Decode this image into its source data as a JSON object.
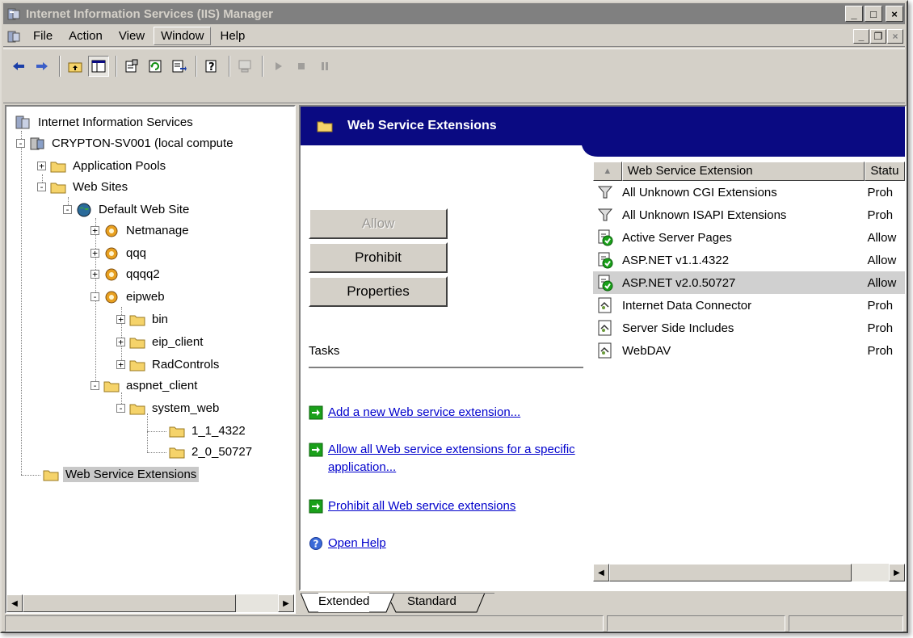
{
  "window": {
    "title": "Internet Information Services (IIS) Manager"
  },
  "caption_buttons": {
    "minimize": "_",
    "maximize": "□",
    "close": "×"
  },
  "menu": {
    "items": [
      {
        "label": "File"
      },
      {
        "label": "Action"
      },
      {
        "label": "View"
      },
      {
        "label": "Window"
      },
      {
        "label": "Help"
      }
    ]
  },
  "tree": {
    "nodes": [
      {
        "label": "Internet Information Services"
      },
      {
        "label": "CRYPTON-SV001 (local compute"
      },
      {
        "label": "Application Pools"
      },
      {
        "label": "Web Sites"
      },
      {
        "label": "Default Web Site"
      },
      {
        "label": "Netmanage"
      },
      {
        "label": "qqq"
      },
      {
        "label": "qqqq2"
      },
      {
        "label": "eipweb"
      },
      {
        "label": "bin"
      },
      {
        "label": "eip_client"
      },
      {
        "label": "RadControls"
      },
      {
        "label": "aspnet_client"
      },
      {
        "label": "system_web"
      },
      {
        "label": "1_1_4322"
      },
      {
        "label": "2_0_50727"
      },
      {
        "label": "Web Service Extensions"
      }
    ],
    "selected": "Web Service Extensions"
  },
  "panel": {
    "header_title": "Web Service Extensions",
    "buttons": {
      "allow": "Allow",
      "prohibit": "Prohibit",
      "properties": "Properties"
    },
    "tasks_label": "Tasks",
    "tasks": [
      {
        "label": "Add a new Web service extension..."
      },
      {
        "label": "Allow all Web service extensions for a specific application..."
      },
      {
        "label": "Prohibit all Web service extensions"
      },
      {
        "label": "Open Help"
      }
    ]
  },
  "list": {
    "sort_glyph": "▲",
    "columns": {
      "name": "Web Service Extension",
      "status": "Statu"
    },
    "rows": [
      {
        "name": "All Unknown CGI Extensions",
        "status": "Proh",
        "icon": "filter-icon"
      },
      {
        "name": "All Unknown ISAPI Extensions",
        "status": "Proh",
        "icon": "filter-icon"
      },
      {
        "name": "Active Server Pages",
        "status": "Allow",
        "icon": "allowed-extension-icon"
      },
      {
        "name": "ASP.NET v1.1.4322",
        "status": "Allow",
        "icon": "allowed-extension-icon"
      },
      {
        "name": "ASP.NET v2.0.50727",
        "status": "Allow",
        "icon": "allowed-extension-icon"
      },
      {
        "name": "Internet Data Connector",
        "status": "Proh",
        "icon": "extension-icon"
      },
      {
        "name": "Server Side Includes",
        "status": "Proh",
        "icon": "extension-icon"
      },
      {
        "name": "WebDAV",
        "status": "Proh",
        "icon": "extension-icon"
      }
    ],
    "selected": "ASP.NET v2.0.50727"
  },
  "tabs": {
    "extended": "Extended",
    "standard": "Standard"
  },
  "colors": {
    "header_bg": "#0a0a82",
    "link": "#0000cc",
    "chrome": "#d4d0c8",
    "selection": "#d0d0d0"
  }
}
